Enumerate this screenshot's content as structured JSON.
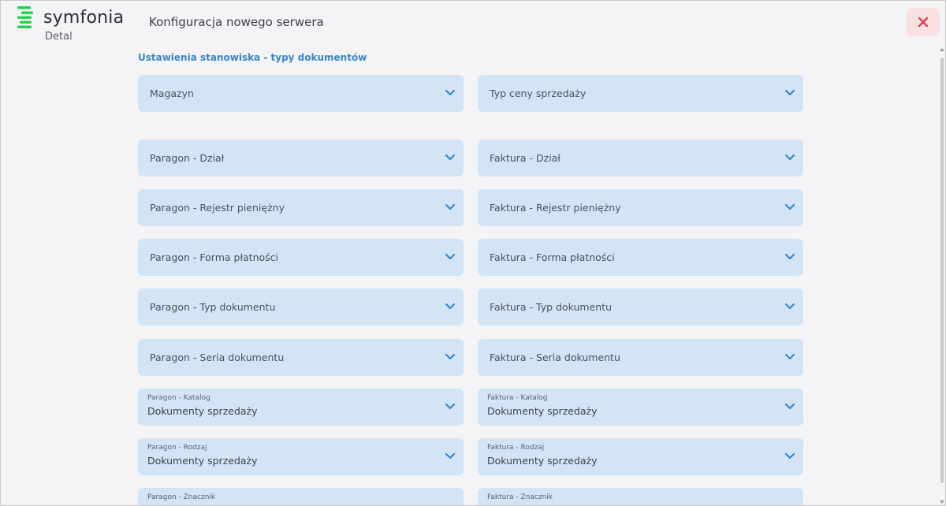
{
  "brand": {
    "name": "symfonia",
    "product": "Detal",
    "accent": "#1fd24a"
  },
  "header": {
    "title": "Konfiguracja nowego serwera"
  },
  "section": {
    "title": "Ustawienia stanowiska - typy dokumentów"
  },
  "fields": {
    "magazyn": {
      "label": "Magazyn"
    },
    "typ_ceny": {
      "label": "Typ ceny sprzedaży"
    },
    "paragon_dzial": {
      "label": "Paragon - Dział"
    },
    "faktura_dzial": {
      "label": "Faktura - Dział"
    },
    "paragon_rejestr": {
      "label": "Paragon - Rejestr pieniężny"
    },
    "faktura_rejestr": {
      "label": "Faktura - Rejestr pieniężny"
    },
    "paragon_forma": {
      "label": "Paragon - Forma płatności"
    },
    "faktura_forma": {
      "label": "Faktura - Forma płatności"
    },
    "paragon_typ": {
      "label": "Paragon - Typ dokumentu"
    },
    "faktura_typ": {
      "label": "Faktura - Typ dokumentu"
    },
    "paragon_seria": {
      "label": "Paragon - Seria dokumentu"
    },
    "faktura_seria": {
      "label": "Faktura - Seria dokumentu"
    },
    "paragon_katalog": {
      "label": "Paragon - Katalog",
      "value": "Dokumenty sprzedaży"
    },
    "faktura_katalog": {
      "label": "Faktura - Katalog",
      "value": "Dokumenty sprzedaży"
    },
    "paragon_rodzaj": {
      "label": "Paragon - Rodzaj",
      "value": "Dokumenty sprzedaży"
    },
    "faktura_rodzaj": {
      "label": "Faktura - Rodzaj",
      "value": "Dokumenty sprzedaży"
    },
    "paragon_znacznik": {
      "label": "Paragon - Znacznik"
    },
    "faktura_znacznik": {
      "label": "Faktura - Znacznik"
    }
  },
  "icons": {
    "chevron": "chevron-down-icon",
    "close": "close-icon"
  },
  "colors": {
    "field_bg": "#d3e5f5",
    "chevron": "#3a86c8",
    "close": "#e0414f",
    "section_title": "#3a86c8"
  }
}
